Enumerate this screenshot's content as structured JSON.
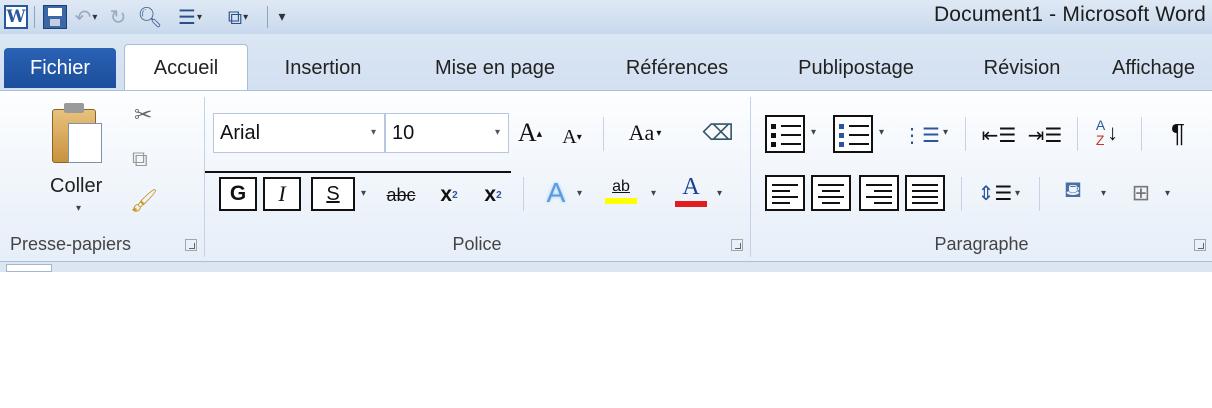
{
  "window": {
    "title": "Document1  -  Microsoft Word",
    "app_icon_letter": "W"
  },
  "tabs": [
    {
      "label": "Fichier"
    },
    {
      "label": "Accueil"
    },
    {
      "label": "Insertion"
    },
    {
      "label": "Mise en page"
    },
    {
      "label": "Références"
    },
    {
      "label": "Publipostage"
    },
    {
      "label": "Révision"
    },
    {
      "label": "Affichage"
    }
  ],
  "ribbon": {
    "clipboard": {
      "label": "Presse-papiers",
      "paste_label": "Coller"
    },
    "font": {
      "label": "Police",
      "font_name": "Arial",
      "font_size": "10",
      "bold": "G",
      "italic": "I",
      "underline": "S",
      "strike": "abc",
      "subscript": "x",
      "superscript": "x",
      "grow": "A",
      "shrink": "A",
      "case": "Aa",
      "highlight": "ab",
      "font_color": "A"
    },
    "paragraph": {
      "label": "Paragraphe",
      "show_marks": "¶"
    }
  },
  "colors": {
    "file_tab": "#1c4e9c",
    "highlight_yellow": "#ffff00",
    "font_color_red": "#e21d1d",
    "accent_blue": "#2b579a"
  },
  "icons": [
    "word-app-icon",
    "save-icon",
    "undo-icon",
    "redo-icon",
    "print-preview-icon",
    "bullets-icon",
    "shapes-icon",
    "customize-qat-icon",
    "paste-icon",
    "cut-icon",
    "copy-icon",
    "format-painter-icon",
    "clear-format-icon",
    "text-effects-icon",
    "highlight-icon",
    "font-color-icon",
    "bullets-icon",
    "numbering-icon",
    "multilevel-list-icon",
    "decrease-indent-icon",
    "increase-indent-icon",
    "sort-icon",
    "show-marks-icon",
    "align-left-icon",
    "center-icon",
    "align-right-icon",
    "justify-icon",
    "line-spacing-icon",
    "shading-icon",
    "borders-icon"
  ]
}
